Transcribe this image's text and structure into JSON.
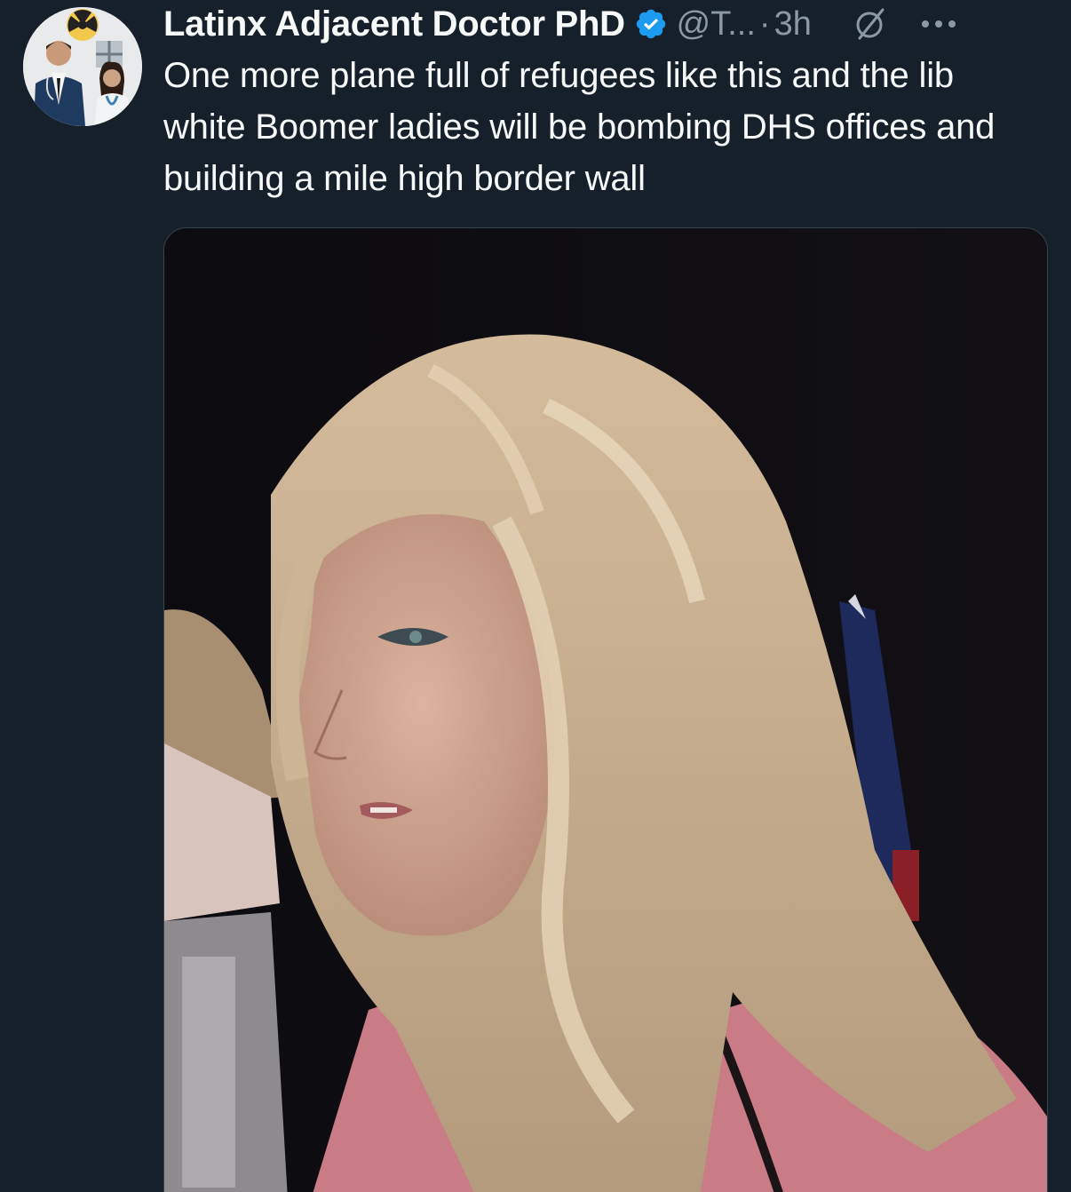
{
  "tweet": {
    "display_name": "Latinx Adjacent Doctor PhD",
    "handle": "@T...",
    "separator": "·",
    "time": "3h",
    "text": "One more plane full of refugees like this and the lib white Boomer ladies will be bombing DHS offices and building a mile high border wall"
  },
  "icons": {
    "avatar": "avatar",
    "verified": "verified-badge-icon",
    "grok": "grok-icon",
    "more": "more-horizontal-icon",
    "media": "photo-thumbnail"
  },
  "colors": {
    "background": "#15202b",
    "text_primary": "#f7f9f9",
    "text_secondary": "#8b98a5",
    "verified_blue": "#1d9bf0",
    "border": "#38444d"
  }
}
